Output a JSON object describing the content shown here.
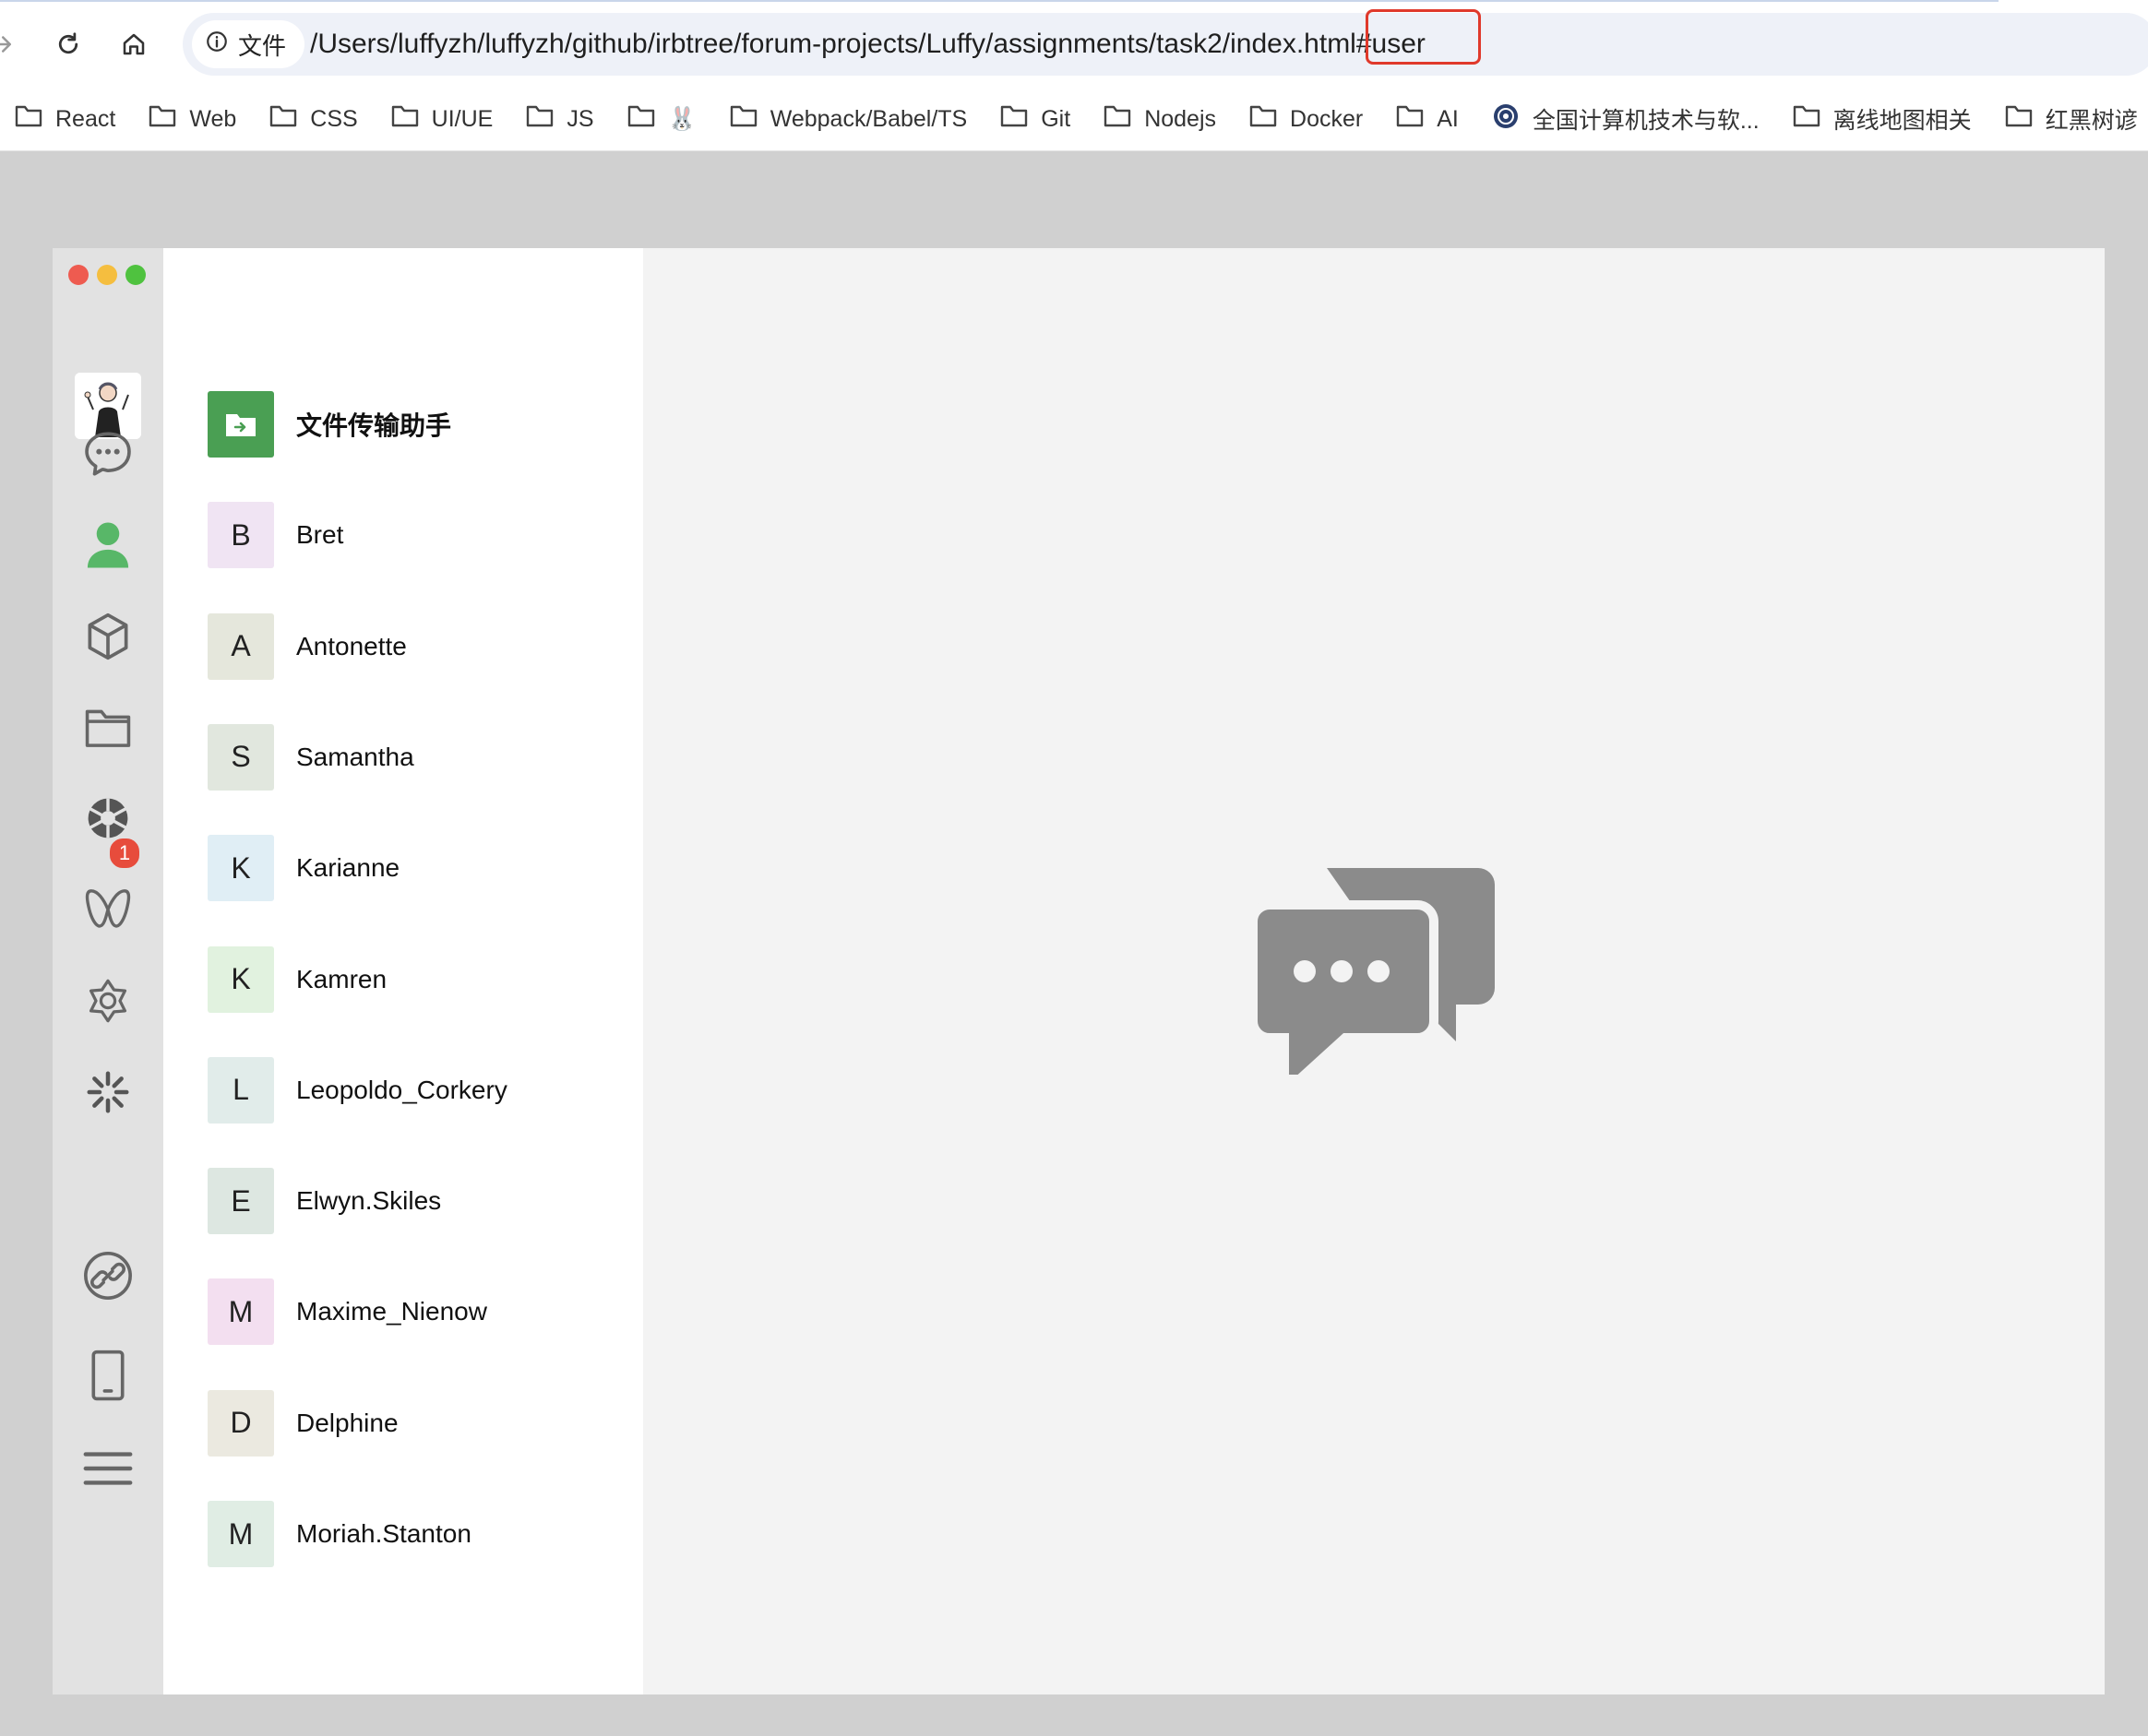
{
  "browser": {
    "nav_icons": [
      "forward-arrow-icon",
      "reload-icon",
      "home-icon"
    ],
    "site_info_label": "文件",
    "url": "/Users/luffyzh/luffyzh/github/irbtree/forum-projects/Luffy/assignments/task2/index.html#user",
    "highlight_color": "#e0392b",
    "bookmarks": [
      {
        "label": "React",
        "icon": "folder-icon"
      },
      {
        "label": "Web",
        "icon": "folder-icon"
      },
      {
        "label": "CSS",
        "icon": "folder-icon"
      },
      {
        "label": "UI/UE",
        "icon": "folder-icon"
      },
      {
        "label": "JS",
        "icon": "folder-icon"
      },
      {
        "label": "🐰",
        "icon": "folder-icon"
      },
      {
        "label": "Webpack/Babel/TS",
        "icon": "folder-icon"
      },
      {
        "label": "Git",
        "icon": "folder-icon"
      },
      {
        "label": "Nodejs",
        "icon": "folder-icon"
      },
      {
        "label": "Docker",
        "icon": "folder-icon"
      },
      {
        "label": "AI",
        "icon": "folder-icon"
      },
      {
        "label": "全国计算机技术与软...",
        "icon": "site-logo-icon"
      },
      {
        "label": "离线地图相关",
        "icon": "folder-icon"
      },
      {
        "label": "红黑树谚",
        "icon": "folder-icon"
      }
    ]
  },
  "app": {
    "window_controls": {
      "close": "#ee5b50",
      "minimize": "#f5be3f",
      "maximize": "#4fc23f"
    },
    "sidebar": {
      "icons": [
        "chat-icon",
        "contacts-icon",
        "box-icon",
        "folder-icon",
        "moments-icon",
        "channels-icon",
        "mini-program-icon",
        "spark-icon",
        "link-icon",
        "phone-icon",
        "menu-icon"
      ],
      "active": "contacts-icon",
      "active_color": "#58b768",
      "badge": "1"
    },
    "contacts": [
      {
        "initial": "",
        "name": "文件传输助手",
        "color": "#4a9f53",
        "icon": "file-transfer-icon"
      },
      {
        "initial": "B",
        "name": "Bret",
        "color": "#f0e4f3"
      },
      {
        "initial": "A",
        "name": "Antonette",
        "color": "#e5e7dc"
      },
      {
        "initial": "S",
        "name": "Samantha",
        "color": "#e1e7de"
      },
      {
        "initial": "K",
        "name": "Karianne",
        "color": "#e0eef5"
      },
      {
        "initial": "K",
        "name": "Kamren",
        "color": "#e1f2df"
      },
      {
        "initial": "L",
        "name": "Leopoldo_Corkery",
        "color": "#e1ecea"
      },
      {
        "initial": "E",
        "name": "Elwyn.Skiles",
        "color": "#dde7e1"
      },
      {
        "initial": "M",
        "name": "Maxime_Nienow",
        "color": "#f3dff0"
      },
      {
        "initial": "D",
        "name": "Delphine",
        "color": "#ebe9e0"
      },
      {
        "initial": "M",
        "name": "Moriah.Stanton",
        "color": "#e0ede4"
      }
    ],
    "main": {
      "placeholder_icon": "chat-bubbles-icon"
    }
  }
}
